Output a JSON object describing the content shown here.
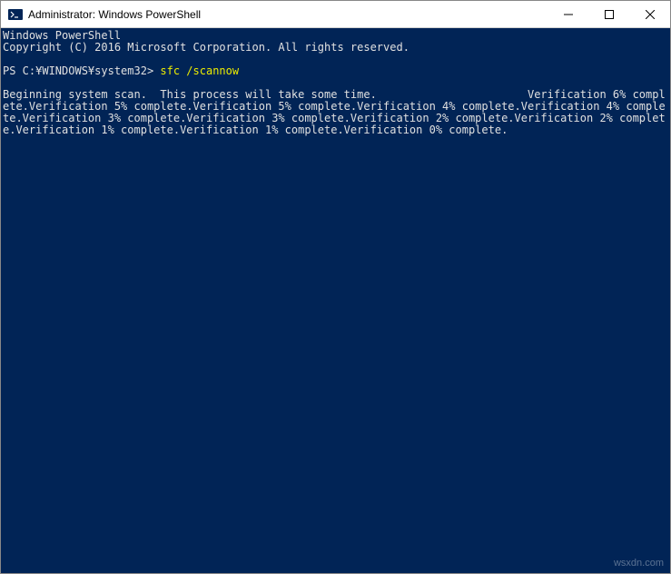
{
  "titlebar": {
    "title": "Administrator: Windows PowerShell",
    "icon": "powershell-icon"
  },
  "terminal": {
    "header_line1": "Windows PowerShell",
    "header_line2": "Copyright (C) 2016 Microsoft Corporation. All rights reserved.",
    "prompt": "PS C:¥WINDOWS¥system32> ",
    "command": "sfc /scannow",
    "output": "Beginning system scan.  This process will take some time.                       Verification 6% complete.Verification 5% complete.Verification 5% complete.Verification 4% complete.Verification 4% complete.Verification 3% complete.Verification 3% complete.Verification 2% complete.Verification 2% complete.Verification 1% complete.Verification 1% complete.Verification 0% complete."
  },
  "watermark": "wsxdn.com"
}
